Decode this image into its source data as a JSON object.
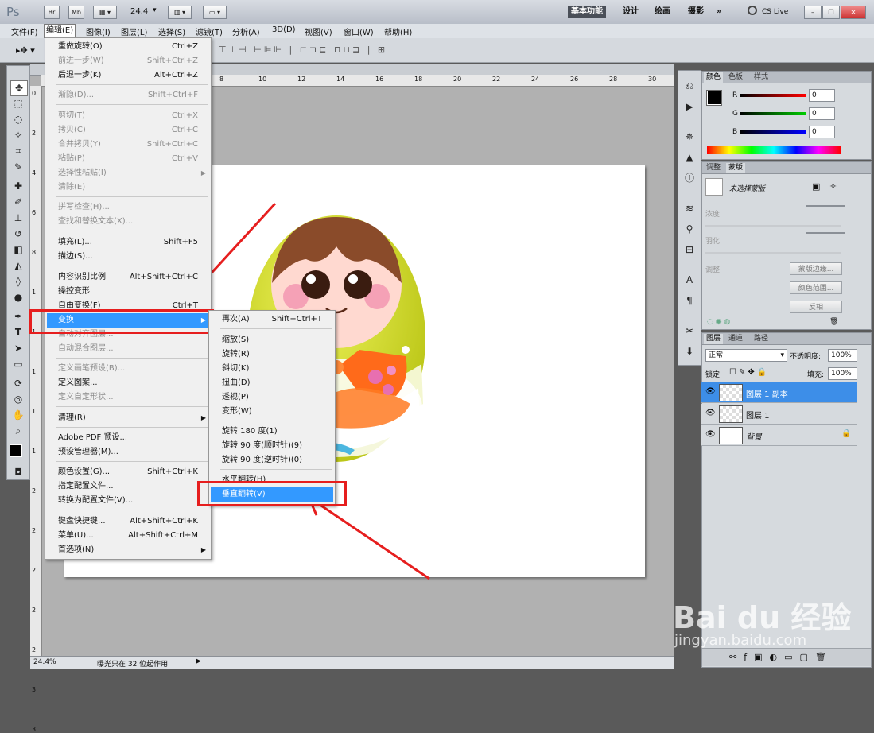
{
  "app": {
    "logo": "Ps",
    "toolbar_buttons": [
      "Br",
      "Mb"
    ],
    "zoom": "24.4",
    "workspaces": [
      "基本功能",
      "设计",
      "绘画",
      "摄影",
      "»"
    ],
    "cs_live": "CS Live"
  },
  "menubar": [
    "文件(F)",
    "编辑(E)",
    "图像(I)",
    "图层(L)",
    "选择(S)",
    "滤镜(T)",
    "分析(A)",
    "3D(D)",
    "视图(V)",
    "窗口(W)",
    "帮助(H)"
  ],
  "edit_menu": [
    {
      "label": "重做旋转(O)",
      "shortcut": "Ctrl+Z"
    },
    {
      "label": "前进一步(W)",
      "shortcut": "Shift+Ctrl+Z"
    },
    {
      "label": "后退一步(K)",
      "shortcut": "Alt+Ctrl+Z"
    },
    {
      "label": "渐隐(D)...",
      "shortcut": "Shift+Ctrl+F"
    },
    {
      "label": "剪切(T)",
      "shortcut": "Ctrl+X"
    },
    {
      "label": "拷贝(C)",
      "shortcut": "Ctrl+C"
    },
    {
      "label": "合并拷贝(Y)",
      "shortcut": "Shift+Ctrl+C"
    },
    {
      "label": "粘贴(P)",
      "shortcut": "Ctrl+V"
    },
    {
      "label": "选择性粘贴(I)",
      "shortcut": ""
    },
    {
      "label": "清除(E)",
      "shortcut": ""
    },
    {
      "label": "拼写检查(H)...",
      "shortcut": ""
    },
    {
      "label": "查找和替换文本(X)...",
      "shortcut": ""
    },
    {
      "label": "填充(L)...",
      "shortcut": "Shift+F5"
    },
    {
      "label": "描边(S)...",
      "shortcut": ""
    },
    {
      "label": "内容识别比例",
      "shortcut": "Alt+Shift+Ctrl+C"
    },
    {
      "label": "操控变形",
      "shortcut": ""
    },
    {
      "label": "自由变换(F)",
      "shortcut": "Ctrl+T"
    },
    {
      "label": "变换",
      "shortcut": ""
    },
    {
      "label": "自动对齐图层...",
      "shortcut": ""
    },
    {
      "label": "自动混合图层...",
      "shortcut": ""
    },
    {
      "label": "定义画笔预设(B)...",
      "shortcut": ""
    },
    {
      "label": "定义图案...",
      "shortcut": ""
    },
    {
      "label": "定义自定形状...",
      "shortcut": ""
    },
    {
      "label": "清理(R)",
      "shortcut": ""
    },
    {
      "label": "Adobe PDF 预设...",
      "shortcut": ""
    },
    {
      "label": "预设管理器(M)...",
      "shortcut": ""
    },
    {
      "label": "颜色设置(G)...",
      "shortcut": "Shift+Ctrl+K"
    },
    {
      "label": "指定配置文件...",
      "shortcut": ""
    },
    {
      "label": "转换为配置文件(V)...",
      "shortcut": ""
    },
    {
      "label": "键盘快捷键...",
      "shortcut": "Alt+Shift+Ctrl+K"
    },
    {
      "label": "菜单(U)...",
      "shortcut": "Alt+Shift+Ctrl+M"
    },
    {
      "label": "首选项(N)",
      "shortcut": ""
    }
  ],
  "transform_menu": [
    {
      "label": "再次(A)",
      "shortcut": "Shift+Ctrl+T"
    },
    {
      "label": "缩放(S)",
      "shortcut": ""
    },
    {
      "label": "旋转(R)",
      "shortcut": ""
    },
    {
      "label": "斜切(K)",
      "shortcut": ""
    },
    {
      "label": "扭曲(D)",
      "shortcut": ""
    },
    {
      "label": "透视(P)",
      "shortcut": ""
    },
    {
      "label": "变形(W)",
      "shortcut": ""
    },
    {
      "label": "旋转 180 度(1)",
      "shortcut": ""
    },
    {
      "label": "旋转 90 度(顺时针)(9)",
      "shortcut": ""
    },
    {
      "label": "旋转 90 度(逆时针)(0)",
      "shortcut": ""
    },
    {
      "label": "水平翻转(H)",
      "shortcut": ""
    },
    {
      "label": "垂直翻转(V)",
      "shortcut": ""
    }
  ],
  "rulers": {
    "h": [
      "8",
      "10",
      "12",
      "14",
      "16",
      "18",
      "20",
      "22",
      "24",
      "26",
      "28",
      "30"
    ],
    "v": [
      "0",
      "2",
      "4",
      "6",
      "8",
      "1",
      "1",
      "1",
      "1",
      "1",
      "2",
      "2",
      "2",
      "2",
      "2",
      "3",
      "3"
    ]
  },
  "color_panel": {
    "tabs": [
      "颜色",
      "色板",
      "样式"
    ],
    "channels": [
      {
        "name": "R",
        "value": "0",
        "color": "#cc0000"
      },
      {
        "name": "G",
        "value": "0",
        "color": "#00aa00"
      },
      {
        "name": "B",
        "value": "0",
        "color": "#0000cc"
      }
    ]
  },
  "masks_panel": {
    "tabs": [
      "调整",
      "蒙版"
    ],
    "title": "未选择蒙版",
    "density_label": "浓度:",
    "feather_label": "羽化:",
    "refine_label": "调整:",
    "buttons": [
      "蒙版边缘...",
      "颜色范围...",
      "反相"
    ]
  },
  "layers_panel": {
    "tabs": [
      "图层",
      "通道",
      "路径"
    ],
    "blend_mode": "正常",
    "opacity_label": "不透明度:",
    "opacity": "100%",
    "lock_label": "锁定:",
    "fill_label": "填充:",
    "fill": "100%",
    "layers": [
      {
        "name": "图层 1 副本",
        "selected": true
      },
      {
        "name": "图层 1",
        "selected": false
      },
      {
        "name": "背景",
        "selected": false
      }
    ],
    "footer_icons": [
      "link-icon",
      "fx-icon",
      "mask-icon",
      "adjustment-icon",
      "group-icon",
      "new-layer-icon",
      "trash-icon"
    ]
  },
  "status": {
    "zoom": "24.4%",
    "message": "曝光只在 32 位起作用"
  },
  "colors": {
    "highlight": "#3399ff",
    "annotation": "#e61e1e",
    "doll_yellow": "#d7e020",
    "doll_orange": "#ff6a1a"
  },
  "watermark": {
    "logo": "Bai du 经验",
    "site": "jingyan.baidu.com"
  }
}
